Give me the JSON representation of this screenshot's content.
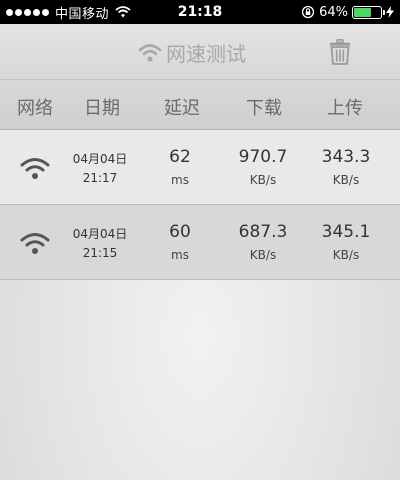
{
  "status_bar": {
    "carrier": "中国移动",
    "time": "21:18",
    "battery_percent": "64%",
    "battery_level": 0.64
  },
  "nav": {
    "title": "网速测试",
    "title_icon": "wifi-icon",
    "action_icon": "trash-icon"
  },
  "columns": [
    "网络",
    "日期",
    "延迟",
    "下载",
    "上传"
  ],
  "records": [
    {
      "network_icon": "wifi-icon",
      "date": "04月04日",
      "time": "21:17",
      "latency": "62",
      "latency_unit": "ms",
      "download": "970.7",
      "download_unit": "KB/s",
      "upload": "343.3",
      "upload_unit": "KB/s"
    },
    {
      "network_icon": "wifi-icon",
      "date": "04月04日",
      "time": "21:15",
      "latency": "60",
      "latency_unit": "ms",
      "download": "687.3",
      "download_unit": "KB/s",
      "upload": "345.1",
      "upload_unit": "KB/s"
    }
  ],
  "colors": {
    "battery_green": "#4cd964",
    "title_gray": "#a8a8a8"
  }
}
